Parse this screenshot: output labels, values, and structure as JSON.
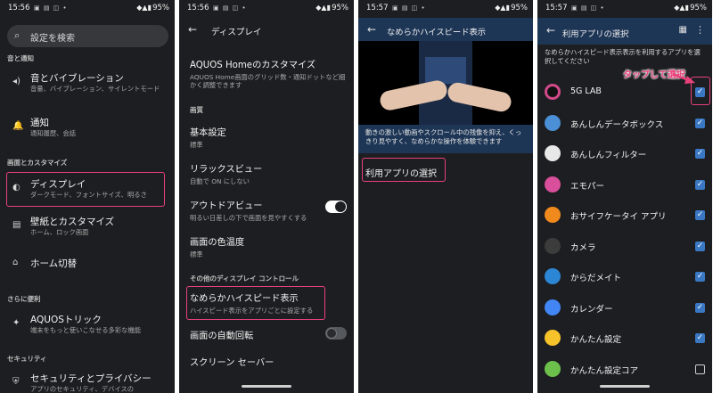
{
  "status": [
    {
      "time": "15:56",
      "battery": "95%"
    },
    {
      "time": "15:56",
      "battery": "95%"
    },
    {
      "time": "15:57",
      "battery": "95%"
    },
    {
      "time": "15:57",
      "battery": "95%"
    }
  ],
  "settings": {
    "search_placeholder": "設定を検索",
    "section_sound": "音と通知",
    "sound": {
      "title": "音とバイブレーション",
      "subtitle": "音量、バイブレーション、サイレントモード"
    },
    "notifications": {
      "title": "通知",
      "subtitle": "通知履歴、会話"
    },
    "section_display": "画面とカスタマイズ",
    "display": {
      "title": "ディスプレイ",
      "subtitle": "ダークモード、フォントサイズ、明るさ"
    },
    "wallpaper": {
      "title": "壁紙とカスタマイズ",
      "subtitle": "ホーム、ロック画面"
    },
    "home_switch": {
      "title": "ホーム切替"
    },
    "section_more": "さらに便利",
    "aquos_trick": {
      "title": "AQUOSトリック",
      "subtitle": "端末をもっと使いこなせる多彩な機能"
    },
    "section_security": "セキュリティ",
    "security": {
      "title": "セキュリティとプライバシー",
      "subtitle": "アプリのセキュリティ、デバイスの"
    }
  },
  "display": {
    "title": "ディスプレイ",
    "aquos_home": {
      "title": "AQUOS Homeのカスタマイズ",
      "subtitle": "AQUOS Home画面のグリッド数・通知ドットなど細かく調整できます"
    },
    "section_picture": "画質",
    "basic": {
      "title": "基本設定",
      "subtitle": "標準"
    },
    "relax": {
      "title": "リラックスビュー",
      "subtitle": "自動で ON にしない"
    },
    "outdoor": {
      "title": "アウトドアビュー",
      "subtitle": "明るい日差しの下で画面を見やすくする"
    },
    "color_temp": {
      "title": "画面の色温度",
      "subtitle": "標準"
    },
    "section_other": "その他のディスプレイ コントロール",
    "smooth": {
      "title": "なめらかハイスピード表示",
      "subtitle": "ハイスピード表示をアプリごとに設定する"
    },
    "auto_rotate": {
      "title": "画面の自動回転"
    },
    "screensaver": {
      "title": "スクリーン セーバー"
    }
  },
  "smooth_page": {
    "title": "なめらかハイスピード表示",
    "description": "動きの激しい動画やスクロール中の残像を抑え、くっきり見やすく、なめらかな操作を体験できます",
    "select_apps": "利用アプリの選択"
  },
  "app_select": {
    "title": "利用アプリの選択",
    "description": "なめらかハイスピード表示表示を利用するアプリを選択してください",
    "annotation": "タップして選択",
    "apps": [
      {
        "name": "5G LAB",
        "icon": "5g-lab-icon",
        "checked": true,
        "color": "#111111"
      },
      {
        "name": "あんしんデータボックス",
        "icon": "data-box-icon",
        "checked": true,
        "color": "#4b8fd6"
      },
      {
        "name": "あんしんフィルター",
        "icon": "filter-icon",
        "checked": true,
        "color": "#e8e8e8"
      },
      {
        "name": "エモパー",
        "icon": "emopa-icon",
        "checked": true,
        "color": "#d94f9b"
      },
      {
        "name": "おサイフケータイ アプリ",
        "icon": "osaifu-icon",
        "checked": true,
        "color": "#f08a1d"
      },
      {
        "name": "カメラ",
        "icon": "camera-icon",
        "checked": true,
        "color": "#3c3c3c"
      },
      {
        "name": "からだメイト",
        "icon": "karada-icon",
        "checked": true,
        "color": "#2c86d6"
      },
      {
        "name": "カレンダー",
        "icon": "calendar-icon",
        "checked": true,
        "color": "#4285f4"
      },
      {
        "name": "かんたん設定",
        "icon": "easy-settings-icon",
        "checked": true,
        "color": "#f6c32b"
      },
      {
        "name": "かんたん設定コア",
        "icon": "easy-settings-core-icon",
        "checked": false,
        "color": "#6cbf4b"
      }
    ]
  }
}
